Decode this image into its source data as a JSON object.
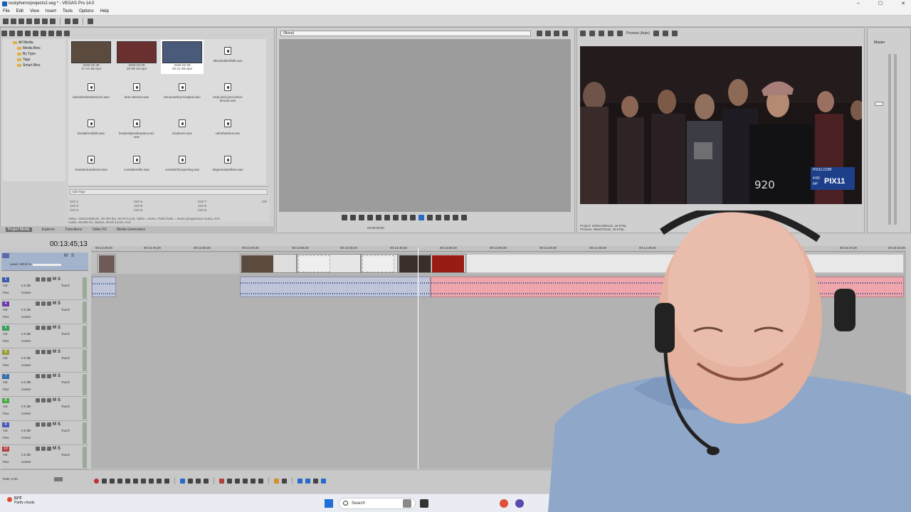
{
  "window": {
    "title": "rockyhorrorprojectv2.veg * - VEGAS Pro 14.0"
  },
  "menu": [
    "File",
    "Edit",
    "View",
    "Insert",
    "Tools",
    "Options",
    "Help"
  ],
  "explorer": {
    "tree": [
      "All Media",
      "Media Bins",
      "By Type",
      "Tags",
      "Smart Bins"
    ],
    "media": [
      {
        "name": "2026-02-28\n17-21-38.mp4",
        "kind": "video"
      },
      {
        "name": "2026-02-28\n20-06-18.mp4",
        "kind": "video"
      },
      {
        "name": "2026-02-28\n20-21-38.mp4",
        "kind": "video"
      },
      {
        "name": "afterdeddiedfellt.wav",
        "kind": "audio"
      },
      {
        "name": "basedonthetelevision.wav",
        "kind": "audio"
      },
      {
        "name": "bear witness.wav",
        "kind": "audio"
      },
      {
        "name": "becausethey'reraped.wav",
        "kind": "audio"
      },
      {
        "name": "brad and janet pelvic\nthrusts.wav",
        "kind": "audio"
      },
      {
        "name": "bradallrestfalls.wav",
        "kind": "audio"
      },
      {
        "name": "bradandjanetkeptaround.\nwav",
        "kind": "audio"
      },
      {
        "name": "bradaxes.wav",
        "kind": "audio"
      },
      {
        "name": "calmthatshot.wav",
        "kind": "audio"
      },
      {
        "name": "clearlytraumatized.wav",
        "kind": "audio"
      },
      {
        "name": "consideredite.wav",
        "kind": "audio"
      },
      {
        "name": "considertheopening.wav",
        "kind": "audio"
      },
      {
        "name": "degeneratevillain.wav",
        "kind": "audio"
      }
    ],
    "tags_placeholder": "Add Tags",
    "shortcuts": [
      "Ctrl+1",
      "Ctrl+4",
      "Ctrl+7",
      "Ctrl+2",
      "Ctrl+5",
      "Ctrl+8",
      "Ctrl+3",
      "Ctrl+6",
      "Ctrl+9",
      "Ctrl"
    ],
    "info_line1": "Video: 1920x1080x32, 30.000 fps, 00:03:14;18, Alpha = None, Field Order = None (progressive scan), AVC",
    "info_line2": "Audio: 48,000 Hz, Stereo, 00:03:14;18, AAC",
    "tabs": [
      "Project Media",
      "Explorer",
      "Transitions",
      "Video FX",
      "Media Generators"
    ]
  },
  "trimmer": {
    "dropdown": "(None)",
    "time": "00:00:00;00"
  },
  "preview": {
    "label": "Preview (Auto)",
    "project_info": "Project: 1920x1080x32, 29.970p",
    "preview_info": "Preview: 480x270x32, 29.970p",
    "station": "PIX11",
    "station_site": "PIX11.COM",
    "ticker_time": "4:56",
    "ticker_temp": "64°"
  },
  "mixer": {
    "label": "Master"
  },
  "timeline": {
    "timecode": "00:13:45;13",
    "ruler": [
      "00:13:29;29",
      "00:13:49;29",
      "00:13:59;29",
      "00:13:59;29",
      "00:13:59;29",
      "00:13:29;29",
      "00:13:49;29",
      "00:13:59;29",
      "00:14:09;29",
      "00:14:29;29",
      "00:14:39;29",
      "00:14:49;29",
      "00:14:59;29",
      "00:15:09;29",
      "00:15:19;29"
    ],
    "video_track": {
      "level": "Level: 100.0 %"
    },
    "audio_tracks": [
      {
        "num": "1",
        "color": "#3a5ea8",
        "vol": "0.0 dB",
        "pan": "Center"
      },
      {
        "num": "4",
        "color": "#6a3aa8",
        "vol": "0.0 dB",
        "pan": "Center"
      },
      {
        "num": "6",
        "color": "#3a9a5a",
        "vol": "0.0 dB",
        "pan": "Center"
      },
      {
        "num": "6",
        "color": "#9a9a3a",
        "vol": "0.0 dB",
        "pan": "Center"
      },
      {
        "num": "7",
        "color": "#3a6ea8",
        "vol": "0.0 dB",
        "pan": "Center"
      },
      {
        "num": "8",
        "color": "#4aa84a",
        "vol": "0.0 dB",
        "pan": "Center"
      },
      {
        "num": "9",
        "color": "#4a5ab8",
        "vol": "0.0 dB",
        "pan": "Center"
      },
      {
        "num": "10",
        "color": "#b83a3a",
        "vol": "0.0 dB",
        "pan": "Center"
      }
    ],
    "labels": {
      "vol": "Vol:",
      "pan": "Pan:",
      "touch": "Touch"
    },
    "rate": "Rate: 0.00"
  },
  "taskbar": {
    "temp": "51°F",
    "condition": "Partly cloudy",
    "search": "Search",
    "colors": {
      "start": "#1f6fd8"
    }
  }
}
